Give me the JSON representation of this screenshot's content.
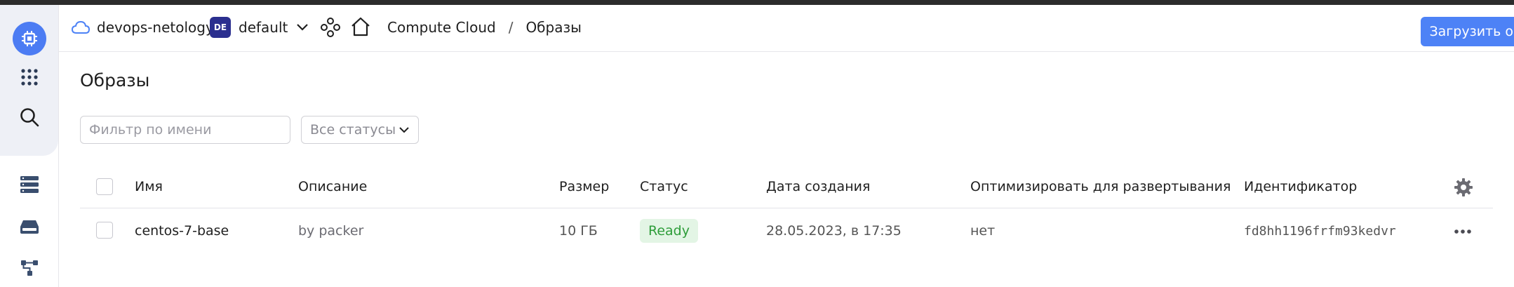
{
  "header": {
    "cloud_name": "devops-netology",
    "folder_badge": "DE",
    "folder_name": "default",
    "breadcrumb_service": "Compute Cloud",
    "breadcrumb_separator": "/",
    "breadcrumb_current": "Образы",
    "upload_button": "Загрузить образ"
  },
  "page": {
    "title": "Образы"
  },
  "filters": {
    "name_placeholder": "Фильтр по имени",
    "status_selected": "Все статусы"
  },
  "table": {
    "columns": {
      "name": "Имя",
      "description": "Описание",
      "size": "Размер",
      "status": "Статус",
      "created": "Дата создания",
      "optimize": "Оптимизировать для развертывания",
      "id": "Идентификатор"
    },
    "rows": [
      {
        "name": "centos-7-base",
        "description": "by packer",
        "size": "10 ГБ",
        "status": "Ready",
        "created": "28.05.2023, в 17:35",
        "optimize": "нет",
        "id": "fd8hh1196frfm93kedvr"
      }
    ]
  },
  "colors": {
    "accent": "#4d82f6",
    "status_ready_bg": "#e3f5e5",
    "status_ready_text": "#2e9d3a",
    "folder_badge_bg": "#2b2f8f"
  },
  "icons": [
    "compute-logo-icon",
    "apps-grid-icon",
    "search-icon",
    "servers-icon",
    "disk-icon",
    "network-icon",
    "cloud-icon",
    "chevron-down-icon",
    "service-graph-icon",
    "home-icon",
    "gear-icon",
    "more-icon"
  ]
}
